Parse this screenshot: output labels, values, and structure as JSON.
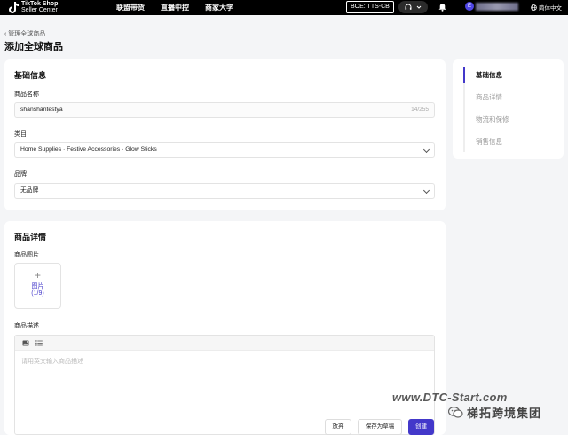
{
  "topbar": {
    "brand_line1": "TikTok Shop",
    "brand_line2": "Seller Center",
    "nav_items": [
      "联盟带货",
      "直播中控",
      "商家大学"
    ],
    "env_badge": "BOE: TTS-CB",
    "avatar_initial": "E",
    "language": "简体中文"
  },
  "breadcrumb": "管理全球商品",
  "page_title": "添加全球商品",
  "basic": {
    "section_title": "基础信息",
    "name_label": "商品名称",
    "name_value": "shanshantestya",
    "name_counter": "14/255",
    "category_label": "类目",
    "category_value": "Home Supplies · Festive Accessories · Glow Sticks",
    "brand_label": "品牌",
    "brand_value": "无品牌"
  },
  "detail": {
    "section_title": "商品详情",
    "images_label": "商品图片",
    "upload_label": "图片",
    "upload_count": "(1/9)",
    "description_label": "商品描述",
    "description_placeholder": "请用英文输入商品描述"
  },
  "side_nav": {
    "items": [
      "基础信息",
      "商品详情",
      "物流和保修",
      "销售信息"
    ],
    "active_index": 0
  },
  "footer": {
    "discard": "放弃",
    "save_draft": "保存为草稿",
    "create": "创建"
  },
  "watermark": {
    "url": "www.DTC-Start.com",
    "name": "梯拓跨境集团"
  },
  "colors": {
    "accent": "#4338ca",
    "topbar": "#000000",
    "background": "#f4f5f7"
  }
}
